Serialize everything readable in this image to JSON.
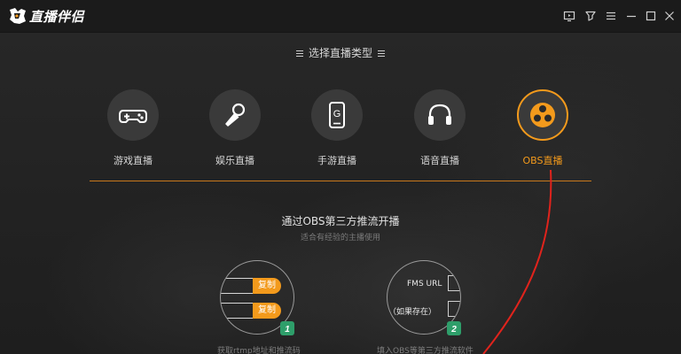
{
  "app": {
    "title": "直播伴侣",
    "window_controls": [
      {
        "name": "screen-icon"
      },
      {
        "name": "pin-icon"
      },
      {
        "name": "menu-icon"
      },
      {
        "name": "minimize-icon"
      },
      {
        "name": "maximize-icon"
      },
      {
        "name": "close-icon"
      }
    ]
  },
  "section": {
    "title": "选择直播类型"
  },
  "categories": [
    {
      "label": "游戏直播",
      "icon": "gamepad-icon",
      "active": false
    },
    {
      "label": "娱乐直播",
      "icon": "microphone-icon",
      "active": false
    },
    {
      "label": "手游直播",
      "icon": "phone-icon",
      "active": false
    },
    {
      "label": "语音直播",
      "icon": "headphones-icon",
      "active": false
    },
    {
      "label": "OBS直播",
      "icon": "obs-icon",
      "active": true
    }
  ],
  "obs": {
    "title": "通过OBS第三方推流开播",
    "subtitle": "适合有经验的主播使用",
    "step1": {
      "badge": "1",
      "copy_label_1": "复制",
      "copy_label_2": "复制",
      "caption": "获取rtmp地址和推流码"
    },
    "step2": {
      "badge": "2",
      "field_1": "FMS URL",
      "field_2": "流（如果存在）",
      "caption": "填入OBS等第三方推流软件"
    }
  },
  "colors": {
    "accent": "#f39a1c",
    "badge": "#2e9e6a",
    "annotation": "#e0231c",
    "background": "#232323",
    "titlebar": "#1b1b1b"
  }
}
